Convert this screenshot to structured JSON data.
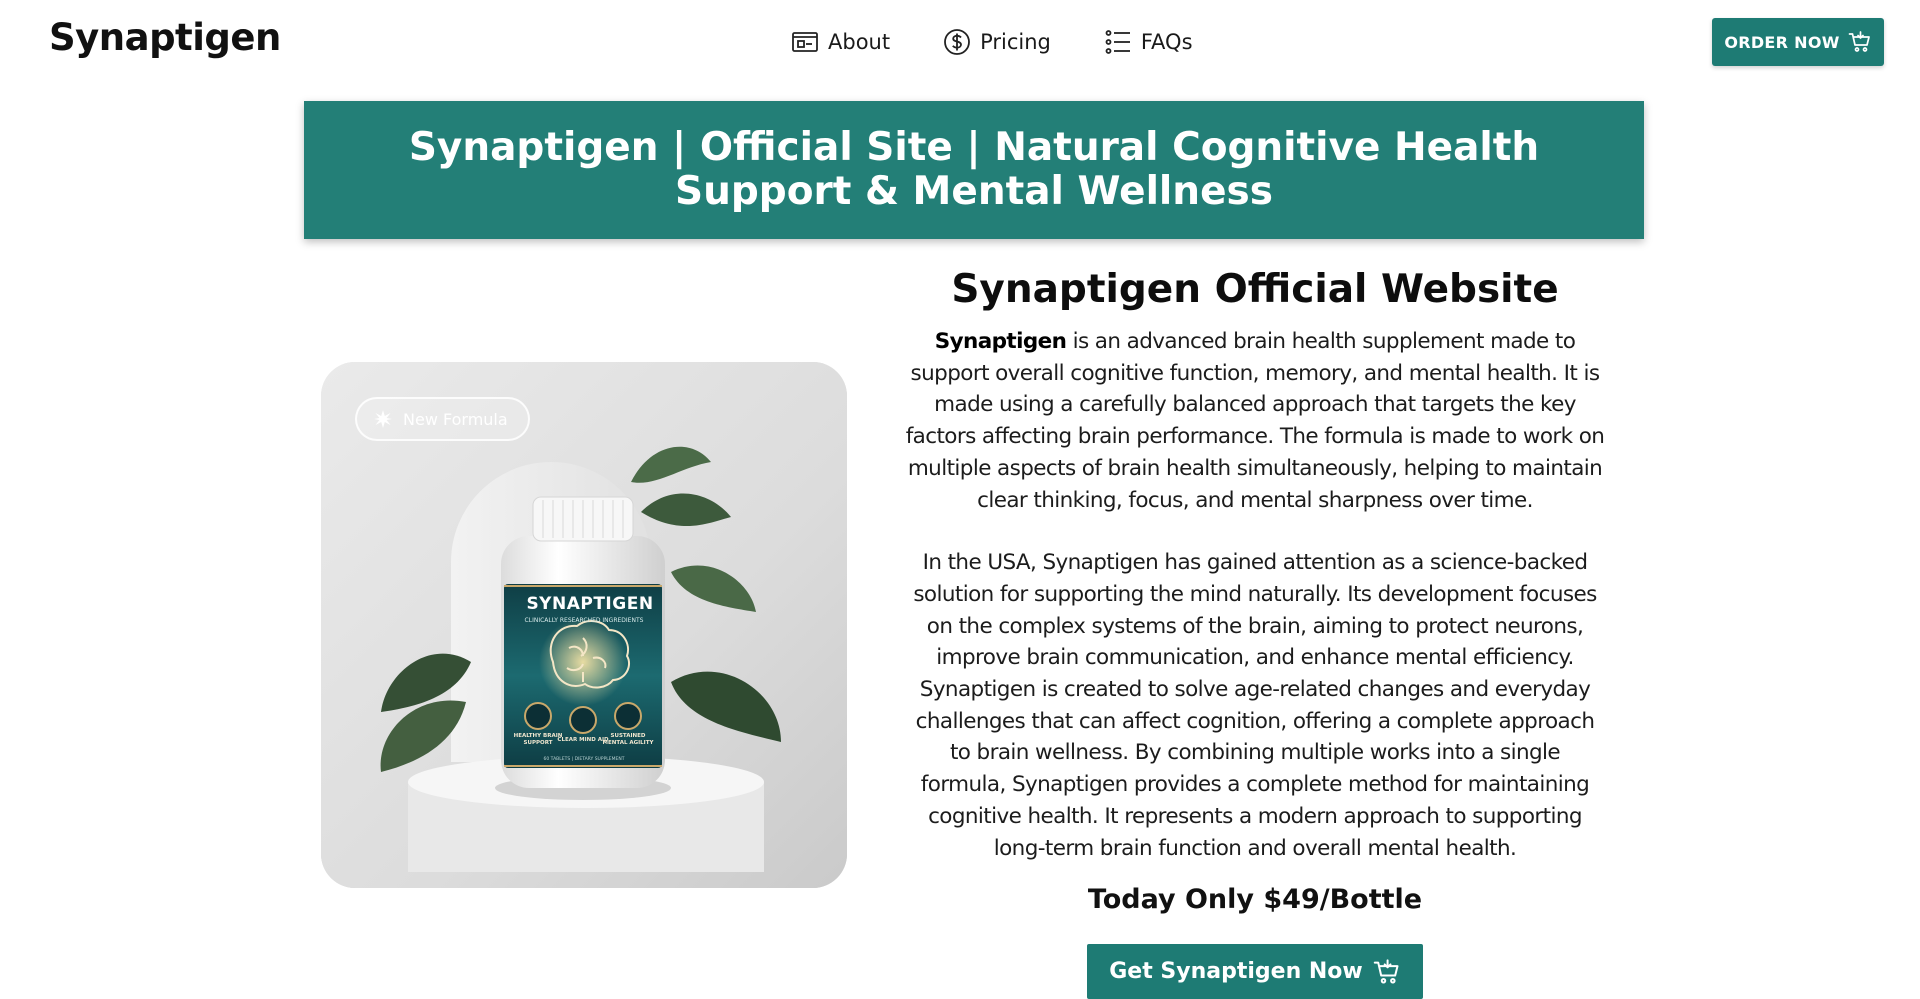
{
  "header": {
    "logo": "Synaptigen",
    "nav": [
      {
        "label": "About",
        "icon": "id-card-icon"
      },
      {
        "label": "Pricing",
        "icon": "dollar-circle-icon"
      },
      {
        "label": "FAQs",
        "icon": "list-icon"
      }
    ],
    "order_button": "ORDER NOW"
  },
  "banner": {
    "title": "Synaptigen | Official Site | Natural Cognitive Health Support & Mental Wellness"
  },
  "product": {
    "badge": "New Formula",
    "bottle": {
      "brand": "SYNAPTIGEN",
      "subtitle": "CLINICALLY RESEARCHED INGREDIENTS",
      "features": [
        "HEALTHY BRAIN SUPPORT",
        "CLEAR MIND AID",
        "SUSTAINED MENTAL AGILITY"
      ],
      "footer": "60 TABLETS | DIETARY SUPPLEMENT"
    }
  },
  "content": {
    "heading": "Synaptigen Official Website",
    "p1_bold": "Synaptigen",
    "p1_rest": " is an advanced brain health supplement made to support overall cognitive function, memory, and mental health. It is made using a carefully balanced approach that targets the key factors affecting brain performance. The formula is made to work on multiple aspects of brain health simultaneously, helping to maintain clear thinking, focus, and mental sharpness over time.",
    "p2": "In the USA, Synaptigen has gained attention as a science-backed solution for supporting the mind naturally. Its development focuses on the complex systems of the brain, aiming to protect neurons, improve brain communication, and enhance mental efficiency. Synaptigen is created to solve age-related changes and everyday challenges that can affect cognition, offering a complete approach to brain wellness. By combining multiple works into a single formula, Synaptigen provides a complete method for maintaining cognitive health. It represents a modern approach to supporting long-term brain function and overall mental health.",
    "price": "Today Only $49/Bottle",
    "cta": "Get Synaptigen Now"
  },
  "colors": {
    "brand_teal": "#1e7b74",
    "banner_teal": "#237f77"
  }
}
